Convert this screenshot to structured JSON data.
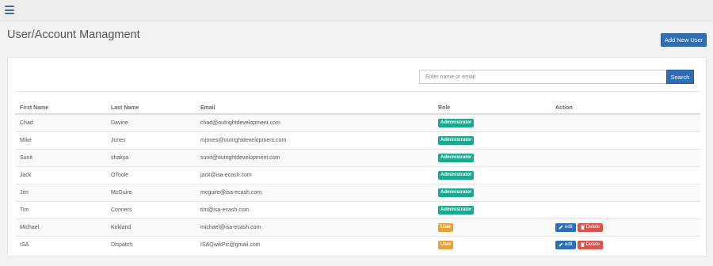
{
  "header": {
    "menu_icon": "hamburger-icon"
  },
  "page": {
    "title": "User/Account Managment",
    "add_button_label": "Add New User"
  },
  "search": {
    "placeholder": "Enter name or email",
    "value": "",
    "button_label": "Search",
    "icon": "none"
  },
  "table": {
    "columns": [
      "First Name",
      "Last Name",
      "Email",
      "Role",
      "Action"
    ],
    "rows": [
      {
        "first": "Chad",
        "last": "Davine",
        "email": "chad@outrightdevelopment.com",
        "role": "Administrator",
        "role_type": "admin",
        "actions": false
      },
      {
        "first": "Mike",
        "last": "Jones",
        "email": "mjones@outrightdevelopment.com",
        "role": "Administrator",
        "role_type": "admin",
        "actions": false
      },
      {
        "first": "Sunit",
        "last": "shakya",
        "email": "sunit@outrightdevelopment.com",
        "role": "Administrator",
        "role_type": "admin",
        "actions": false
      },
      {
        "first": "Jack",
        "last": "OToole",
        "email": "jack@isa-ecash.com",
        "role": "Administrator",
        "role_type": "admin",
        "actions": false
      },
      {
        "first": "Jim",
        "last": "McGuire",
        "email": "mcguire@isa-ecash.com",
        "role": "Administrator",
        "role_type": "admin",
        "actions": false
      },
      {
        "first": "Tim",
        "last": "Conners",
        "email": "tim@isa-ecash.com",
        "role": "Administrator",
        "role_type": "admin",
        "actions": false
      },
      {
        "first": "Michael",
        "last": "Kirkland",
        "email": "michael@isa-ecash.com",
        "role": "User",
        "role_type": "user",
        "actions": true
      },
      {
        "first": "ISA",
        "last": "Dispatch",
        "email": "ISAQwikPic@gmail.com",
        "role": "User",
        "role_type": "user",
        "actions": true
      }
    ],
    "edit_label": "edit",
    "delete_label": "Delete",
    "edit_icon": "pencil-icon",
    "delete_icon": "trash-icon"
  },
  "colors": {
    "primary": "#2f6eb5",
    "admin_badge": "#1aa88e",
    "user_badge": "#e9a23b",
    "danger": "#d9534f"
  }
}
